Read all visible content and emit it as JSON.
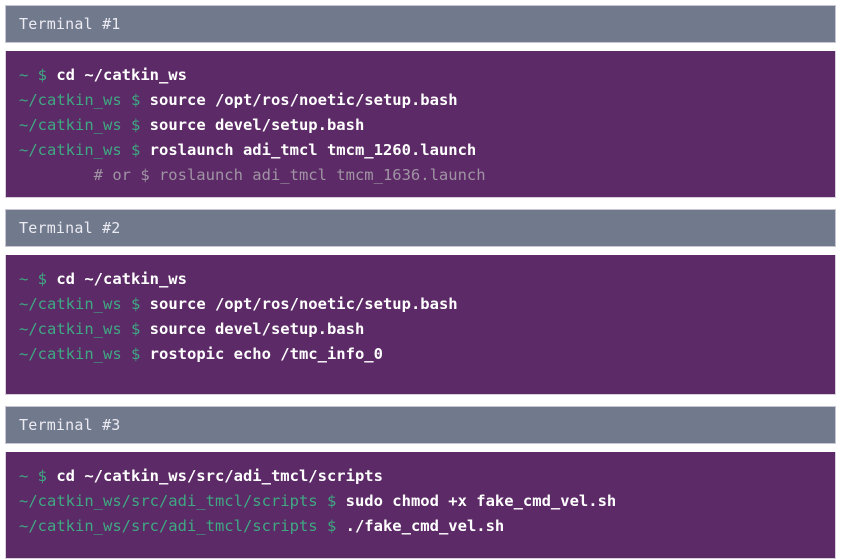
{
  "page": {
    "background_color": "#ffffff",
    "header_bg_color": "#707a8c",
    "terminal_bg_color": "#5c2a66",
    "prompt_color": "#3fa883",
    "command_color": "#ffffff",
    "comment_color": "#a094a4"
  },
  "terminals": [
    {
      "title": "Terminal #1",
      "lines": [
        {
          "prompt": "~ $ ",
          "command": "cd ~/catkin_ws",
          "type": "command"
        },
        {
          "prompt": "~/catkin_ws $ ",
          "command": "source /opt/ros/noetic/setup.bash",
          "type": "command"
        },
        {
          "prompt": "~/catkin_ws $ ",
          "command": "source devel/setup.bash",
          "type": "command"
        },
        {
          "prompt": "~/catkin_ws $ ",
          "command": "roslaunch adi_tmcl tmcm_1260.launch",
          "type": "command"
        },
        {
          "prompt": "",
          "command": "        # or $ roslaunch adi_tmcl tmcm_1636.launch",
          "type": "comment"
        }
      ]
    },
    {
      "title": "Terminal #2",
      "lines": [
        {
          "prompt": "~ $ ",
          "command": "cd ~/catkin_ws",
          "type": "command"
        },
        {
          "prompt": "~/catkin_ws $ ",
          "command": "source /opt/ros/noetic/setup.bash",
          "type": "command"
        },
        {
          "prompt": "~/catkin_ws $ ",
          "command": "source devel/setup.bash",
          "type": "command"
        },
        {
          "prompt": "~/catkin_ws $ ",
          "command": "rostopic echo /tmc_info_0",
          "type": "command"
        }
      ]
    },
    {
      "title": "Terminal #3",
      "lines": [
        {
          "prompt": "~ $ ",
          "command": "cd ~/catkin_ws/src/adi_tmcl/scripts",
          "type": "command"
        },
        {
          "prompt": "~/catkin_ws/src/adi_tmcl/scripts $ ",
          "command": "sudo chmod +x fake_cmd_vel.sh",
          "type": "command"
        },
        {
          "prompt": "~/catkin_ws/src/adi_tmcl/scripts $ ",
          "command": "./fake_cmd_vel.sh",
          "type": "command"
        }
      ]
    }
  ]
}
